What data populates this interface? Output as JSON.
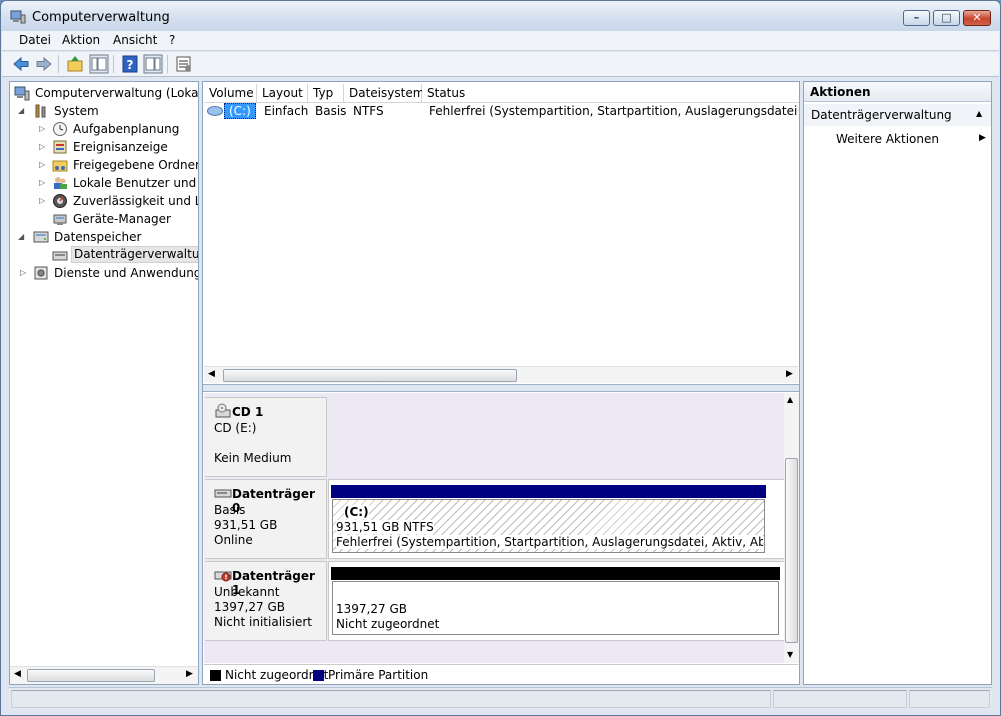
{
  "window": {
    "title": "Computerverwaltung",
    "buttons": {
      "minimize": "–",
      "maximize": "□",
      "close": "✕"
    }
  },
  "menubar": {
    "items": [
      "Datei",
      "Aktion",
      "Ansicht",
      "?"
    ]
  },
  "toolbar": {
    "icons": [
      "back-arrow-icon",
      "forward-arrow-icon",
      "up-folder-icon",
      "show-hide-console-tree-icon",
      "help-icon",
      "show-hide-action-pane-icon",
      "properties-icon"
    ]
  },
  "tree": {
    "root": "Computerverwaltung (Lokal)",
    "items": [
      {
        "label": "System",
        "icon": "tools-icon"
      },
      {
        "label": "Aufgabenplanung",
        "icon": "clock-icon"
      },
      {
        "label": "Ereignisanzeige",
        "icon": "event-viewer-icon"
      },
      {
        "label": "Freigegebene Ordner",
        "icon": "shared-folder-icon"
      },
      {
        "label": "Lokale Benutzer und Gruppen",
        "icon": "users-icon"
      },
      {
        "label": "Zuverlässigkeit und Leistung",
        "icon": "performance-icon"
      },
      {
        "label": "Geräte-Manager",
        "icon": "device-manager-icon"
      },
      {
        "label": "Datenspeicher",
        "icon": "storage-icon"
      },
      {
        "label": "Datenträgerverwaltung",
        "icon": "disk-management-icon"
      },
      {
        "label": "Dienste und Anwendungen",
        "icon": "services-icon"
      }
    ]
  },
  "volumes": {
    "columns": [
      "Volume",
      "Layout",
      "Typ",
      "Dateisystem",
      "Status"
    ],
    "rows": [
      {
        "volume": "(C:)",
        "layout": "Einfach",
        "type": "Basis",
        "filesystem": "NTFS",
        "status": "Fehlerfrei (Systempartition, Startpartition, Auslagerungsdatei, Aktiv, Absturzabbild, Primäre Partition)"
      }
    ]
  },
  "disks": {
    "cd1": {
      "name": "CD 1",
      "line1": "CD (E:)",
      "line2": "Kein Medium"
    },
    "disk0": {
      "name": "Datenträger 0",
      "line1": "Basis",
      "line2": "931,51 GB",
      "line3": "Online",
      "partition": {
        "title": "(C:)",
        "size": "931,51 GB NTFS",
        "status": "Fehlerfrei (Systempartition, Startpartition, Auslagerungsdatei, Aktiv, Absturzabbild, Primäre Partition)"
      }
    },
    "disk1": {
      "name": "Datenträger 1",
      "line1": "Unbekannt",
      "line2": "1397,27 GB",
      "line3": "Nicht initialisiert",
      "partition": {
        "size": "1397,27 GB",
        "status": "Nicht zugeordnet"
      }
    }
  },
  "legend": [
    {
      "label": "Nicht zugeordnet",
      "color": "#000000"
    },
    {
      "label": "Primäre Partition",
      "color": "#000080"
    }
  ],
  "actions": {
    "header": "Aktionen",
    "section": "Datenträgerverwaltung",
    "item": "Weitere Aktionen"
  },
  "colors": {
    "primary_partition": "#000080",
    "unallocated": "#000000",
    "selection": "#3399ff"
  }
}
